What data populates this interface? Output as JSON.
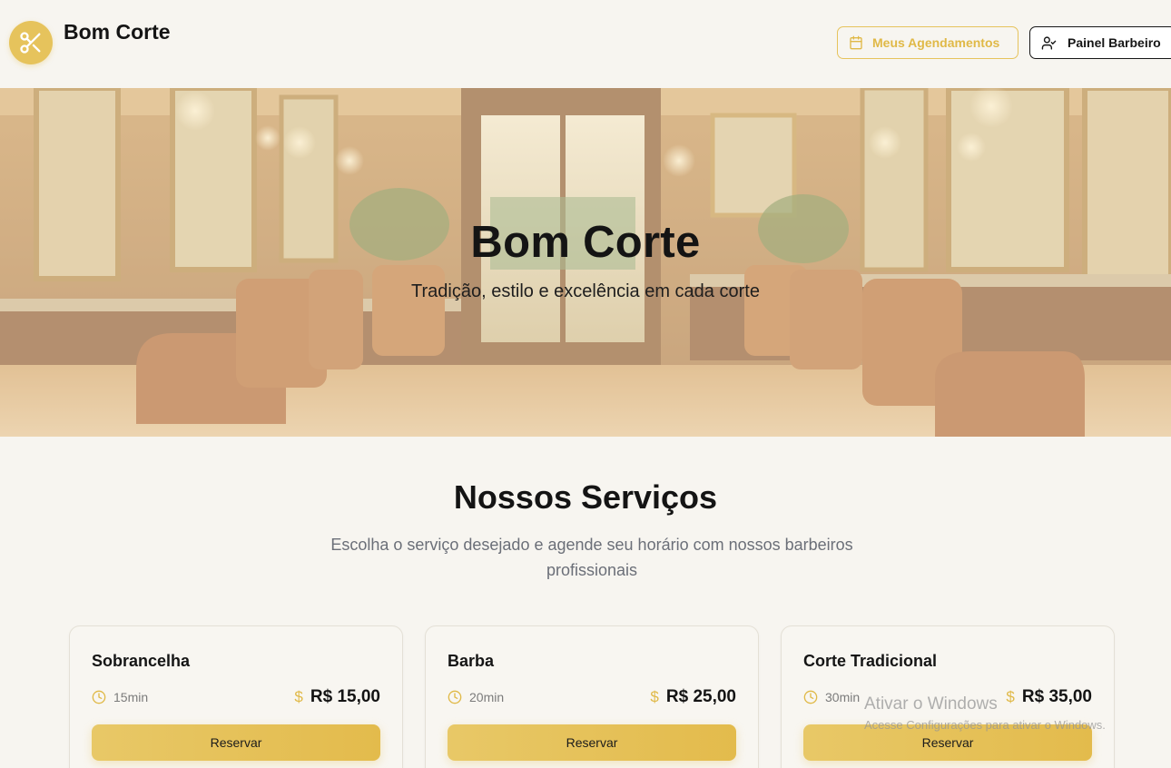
{
  "header": {
    "brand": "Bom Corte",
    "bookings_label": "Meus Agendamentos",
    "panel_label": "Painel Barbeiro"
  },
  "hero": {
    "title": "Bom Corte",
    "subtitle": "Tradição, estilo e excelência em cada corte"
  },
  "services": {
    "title": "Nossos Serviços",
    "subtitle": "Escolha o serviço desejado e agende seu horário com nossos barbeiros profissionais",
    "items": [
      {
        "name": "Sobrancelha",
        "duration": "15min",
        "currency": "$",
        "price": "R$ 15,00",
        "button": "Reservar"
      },
      {
        "name": "Barba",
        "duration": "20min",
        "currency": "$",
        "price": "R$ 25,00",
        "button": "Reservar"
      },
      {
        "name": "Corte Tradicional",
        "duration": "30min",
        "currency": "$",
        "price": "R$ 35,00",
        "button": "Reservar"
      }
    ]
  },
  "watermark": {
    "line1": "Ativar o Windows",
    "line2": "Acesse Configurações para ativar o Windows."
  },
  "colors": {
    "accent": "#e6c35c",
    "background": "#f7f5f0",
    "text": "#141414",
    "muted": "#6b6f78"
  },
  "icons": {
    "logo": "scissors-icon",
    "bookings": "calendar-icon",
    "panel": "user-check-icon",
    "duration": "clock-icon",
    "price": "dollar-icon"
  }
}
